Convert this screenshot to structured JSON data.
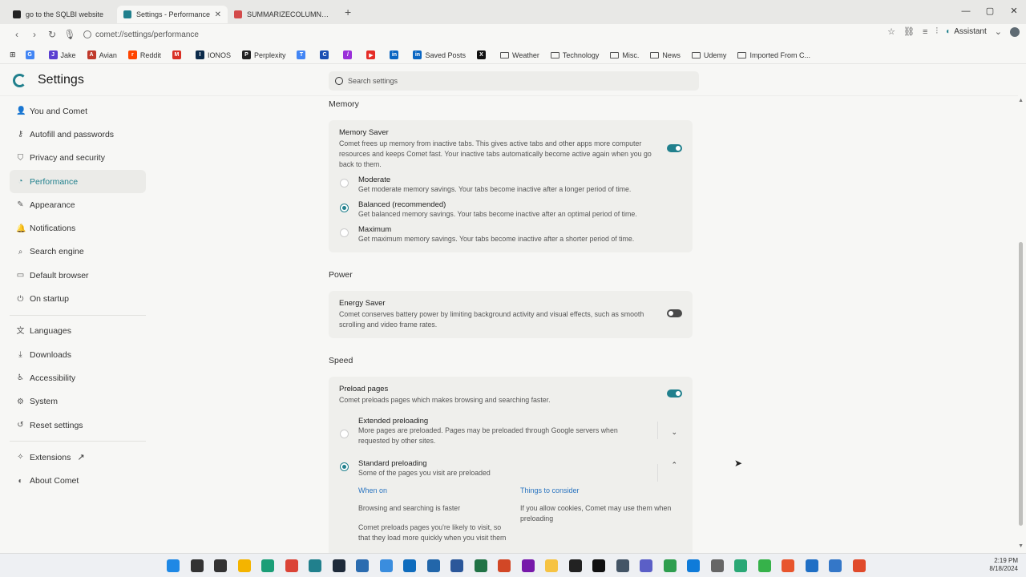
{
  "tabs": [
    {
      "label": "go to the SQLBI website",
      "favicon_color": "#222222"
    },
    {
      "label": "Settings - Performance",
      "favicon_color": "#21808d"
    },
    {
      "label": "SUMMARIZECOLUMNS best p",
      "favicon_color": "#d34a4a"
    }
  ],
  "toolbar": {
    "url": "comet://settings/performance",
    "assistant_label": "Assistant"
  },
  "bookmarks": [
    {
      "label": "",
      "icon": "google-icon",
      "color": "#4285f4",
      "letter": "G"
    },
    {
      "label": "Jake",
      "icon": "jake-icon",
      "color": "#5a3fd1",
      "letter": "J"
    },
    {
      "label": "Avian",
      "icon": "avian-icon",
      "color": "#c0392b",
      "letter": "A"
    },
    {
      "label": "Reddit",
      "icon": "reddit-icon",
      "color": "#ff4500",
      "letter": "r"
    },
    {
      "label": "",
      "icon": "gmail-icon",
      "color": "#d93025",
      "letter": "M"
    },
    {
      "label": "IONOS",
      "icon": "ionos-icon",
      "color": "#0b2a4a",
      "letter": "I"
    },
    {
      "label": "Perplexity",
      "icon": "perplexity-icon",
      "color": "#222222",
      "letter": "P"
    },
    {
      "label": "",
      "icon": "translate-icon",
      "color": "#4285f4",
      "letter": "T"
    },
    {
      "label": "",
      "icon": "cbs-icon",
      "color": "#1a4fb3",
      "letter": "C"
    },
    {
      "label": "",
      "icon": "pen-icon",
      "color": "#9b30d9",
      "letter": "/"
    },
    {
      "label": "",
      "icon": "youtube-icon",
      "color": "#e52d27",
      "letter": "▶"
    },
    {
      "label": "",
      "icon": "linkedin-icon",
      "color": "#0a66c2",
      "letter": "in"
    },
    {
      "label": "Saved Posts",
      "icon": "linkedin-icon",
      "color": "#0a66c2",
      "letter": "in"
    },
    {
      "label": "",
      "icon": "x-icon",
      "color": "#111111",
      "letter": "X"
    },
    {
      "label": "Weather",
      "icon": "folder-icon",
      "folder": true
    },
    {
      "label": "Technology",
      "icon": "folder-icon",
      "folder": true
    },
    {
      "label": "Misc.",
      "icon": "folder-icon",
      "folder": true
    },
    {
      "label": "News",
      "icon": "folder-icon",
      "folder": true
    },
    {
      "label": "Udemy",
      "icon": "folder-icon",
      "folder": true
    },
    {
      "label": "Imported From C...",
      "icon": "folder-icon",
      "folder": true
    }
  ],
  "header": {
    "title": "Settings",
    "search_placeholder": "Search settings"
  },
  "sidebar": {
    "groups": [
      [
        {
          "label": "You and Comet",
          "icon": "person-icon",
          "glyph": "👤"
        },
        {
          "label": "Autofill and passwords",
          "icon": "key-icon",
          "glyph": "⚷"
        },
        {
          "label": "Privacy and security",
          "icon": "shield-icon",
          "glyph": "⛉"
        },
        {
          "label": "Performance",
          "icon": "gauge-icon",
          "glyph": "◔",
          "active": true
        },
        {
          "label": "Appearance",
          "icon": "brush-icon",
          "glyph": "✎"
        },
        {
          "label": "Notifications",
          "icon": "bell-icon",
          "glyph": "🔔"
        },
        {
          "label": "Search engine",
          "icon": "search-icon",
          "glyph": "⌕"
        },
        {
          "label": "Default browser",
          "icon": "browser-icon",
          "glyph": "▭"
        },
        {
          "label": "On startup",
          "icon": "power-icon",
          "glyph": "⏻"
        }
      ],
      [
        {
          "label": "Languages",
          "icon": "translate-icon",
          "glyph": "文"
        },
        {
          "label": "Downloads",
          "icon": "download-icon",
          "glyph": "⤓"
        },
        {
          "label": "Accessibility",
          "icon": "accessibility-icon",
          "glyph": "♿"
        },
        {
          "label": "System",
          "icon": "system-icon",
          "glyph": "⚙"
        },
        {
          "label": "Reset settings",
          "icon": "reset-icon",
          "glyph": "↺"
        }
      ],
      [
        {
          "label": "Extensions",
          "icon": "puzzle-icon",
          "glyph": "✧",
          "external": true
        },
        {
          "label": "About Comet",
          "icon": "comet-icon",
          "glyph": "◐"
        }
      ]
    ]
  },
  "memory": {
    "section_title": "Memory",
    "saver_title": "Memory Saver",
    "saver_desc": "Comet frees up memory from inactive tabs. This gives active tabs and other apps more computer resources and keeps Comet fast. Your inactive tabs automatically become active again when you go back to them.",
    "saver_on": true,
    "options": [
      {
        "title": "Moderate",
        "desc": "Get moderate memory savings. Your tabs become inactive after a longer period of time.",
        "checked": false
      },
      {
        "title": "Balanced (recommended)",
        "desc": "Get balanced memory savings. Your tabs become inactive after an optimal period of time.",
        "checked": true
      },
      {
        "title": "Maximum",
        "desc": "Get maximum memory savings. Your tabs become inactive after a shorter period of time.",
        "checked": false
      }
    ]
  },
  "power": {
    "section_title": "Power",
    "saver_title": "Energy Saver",
    "saver_desc": "Comet conserves battery power by limiting background activity and visual effects, such as smooth scrolling and video frame rates.",
    "saver_on": false
  },
  "speed": {
    "section_title": "Speed",
    "preload_title": "Preload pages",
    "preload_desc": "Comet preloads pages which makes browsing and searching faster.",
    "preload_on": true,
    "extended": {
      "title": "Extended preloading",
      "desc": "More pages are preloaded. Pages may be preloaded through Google servers when requested by other sites.",
      "checked": false
    },
    "standard": {
      "title": "Standard preloading",
      "desc": "Some of the pages you visit are preloaded",
      "checked": true
    },
    "when_on": {
      "heading": "When on",
      "items": [
        "Browsing and searching is faster",
        "Comet preloads pages you're likely to visit, so that they load more quickly when you visit them"
      ]
    },
    "consider": {
      "heading": "Things to consider",
      "items": [
        "If you allow cookies, Comet may use them when preloading"
      ]
    }
  },
  "taskbar": {
    "time": "2:19 PM",
    "date": "8/18/2024",
    "icons": [
      {
        "name": "start-icon",
        "color": "#1e88e5"
      },
      {
        "name": "search-icon",
        "color": "#333333"
      },
      {
        "name": "task-view-icon",
        "color": "#333333"
      },
      {
        "name": "file-explorer-icon",
        "color": "#f4b400"
      },
      {
        "name": "edge-icon",
        "color": "#1b9e77"
      },
      {
        "name": "chrome-icon",
        "color": "#db4437"
      },
      {
        "name": "comet-icon",
        "color": "#21808d"
      },
      {
        "name": "terminal-icon",
        "color": "#1e2a3a"
      },
      {
        "name": "app-icon",
        "color": "#2b6cb0"
      },
      {
        "name": "app-icon",
        "color": "#3a8dde"
      },
      {
        "name": "outlook-icon",
        "color": "#0f6cbd"
      },
      {
        "name": "outlook-icon",
        "color": "#2266aa"
      },
      {
        "name": "word-icon",
        "color": "#2b579a"
      },
      {
        "name": "excel-icon",
        "color": "#217346"
      },
      {
        "name": "powerpoint-icon",
        "color": "#d24726"
      },
      {
        "name": "onenote-icon",
        "color": "#7719aa"
      },
      {
        "name": "notes-icon",
        "color": "#f6c343"
      },
      {
        "name": "app-icon",
        "color": "#222222"
      },
      {
        "name": "app-icon",
        "color": "#111111"
      },
      {
        "name": "dax-icon",
        "color": "#445566"
      },
      {
        "name": "teams-icon",
        "color": "#5b5fc7"
      },
      {
        "name": "app-icon",
        "color": "#2e9e4f"
      },
      {
        "name": "app-icon",
        "color": "#0f7bd9"
      },
      {
        "name": "app-icon",
        "color": "#666666"
      },
      {
        "name": "app-icon",
        "color": "#2aa876"
      },
      {
        "name": "app-icon",
        "color": "#36b24a"
      },
      {
        "name": "app-icon",
        "color": "#e8552d"
      },
      {
        "name": "app-icon",
        "color": "#1f6fc5"
      },
      {
        "name": "app-icon",
        "color": "#3477c8"
      },
      {
        "name": "app-icon",
        "color": "#e04a2b"
      }
    ]
  },
  "colors": {
    "accent": "#21808d",
    "link": "#2a74c0"
  }
}
